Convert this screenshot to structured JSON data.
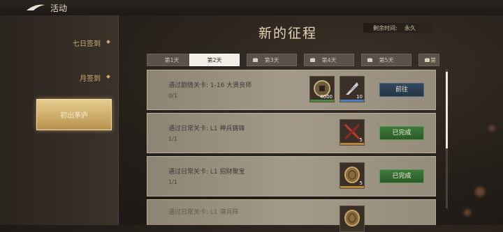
{
  "topbar": {
    "title": "活动"
  },
  "sidebar": {
    "items": [
      {
        "label": "七日签到"
      },
      {
        "label": "月签到"
      },
      {
        "label": "初出茅庐"
      }
    ]
  },
  "header": {
    "title": "新的征程",
    "remain_label": "剩余时间:",
    "remain_value": "永久"
  },
  "tabs": [
    {
      "label": "第1天",
      "locked": false
    },
    {
      "label": "第2天",
      "locked": false,
      "active": true
    },
    {
      "label": "第3天",
      "locked": true
    },
    {
      "label": "第4天",
      "locked": true
    },
    {
      "label": "第5天",
      "locked": true
    },
    {
      "label": "第",
      "locked": true
    }
  ],
  "quests": [
    {
      "title": "通过剧情关卡: 1-16 大贤良师",
      "progress": "0/1",
      "rewards": [
        {
          "icon": "coin-icon",
          "count": "4000"
        },
        {
          "icon": "feather-icon",
          "count": "10"
        }
      ],
      "button": "前往",
      "status": "go"
    },
    {
      "title": "通过日常关卡: L1 神兵铸锋",
      "progress": "1/1",
      "rewards": [
        {
          "icon": "crossed-swords-icon",
          "count": "5"
        }
      ],
      "button": "已完成",
      "status": "done"
    },
    {
      "title": "通过日常关卡: L1 招财聚宝",
      "progress": "1/1",
      "rewards": [
        {
          "icon": "bronze-coin-icon",
          "count": "5"
        }
      ],
      "button": "已完成",
      "status": "done"
    },
    {
      "title": "通过日常关卡: L1 演兵阵",
      "progress": "",
      "rewards": [
        {
          "icon": "bronze-coin-icon",
          "count": ""
        }
      ],
      "button": "",
      "status": "partial"
    }
  ],
  "colors": {
    "accent_gold": "#c9ac74",
    "done_green": "#3e7a3a",
    "go_blue": "#2c3e54"
  }
}
